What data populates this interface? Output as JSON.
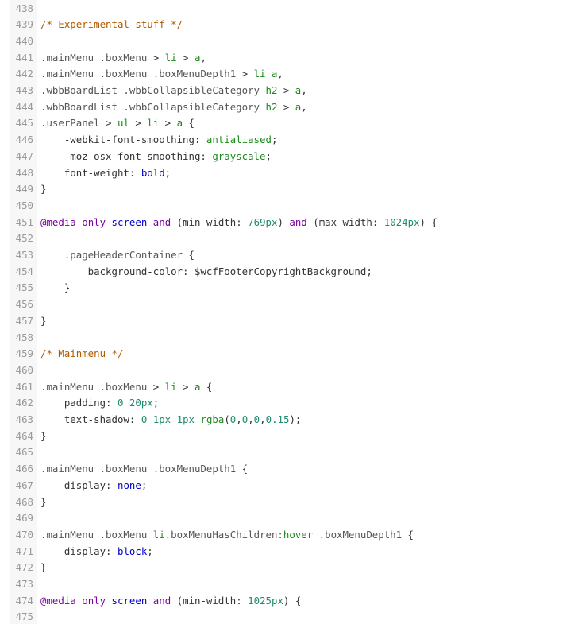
{
  "lines": [
    {
      "n": "438",
      "tokens": []
    },
    {
      "n": "439",
      "tokens": [
        {
          "c": "t-comment",
          "t": "/* Experimental stuff */"
        }
      ]
    },
    {
      "n": "440",
      "tokens": []
    },
    {
      "n": "441",
      "tokens": [
        {
          "c": "t-sel",
          "t": ".mainMenu .boxMenu "
        },
        {
          "c": "t-plain",
          "t": "> "
        },
        {
          "c": "t-tag",
          "t": "li"
        },
        {
          "c": "t-plain",
          "t": " > "
        },
        {
          "c": "t-tag",
          "t": "a"
        },
        {
          "c": "t-plain",
          "t": ","
        }
      ]
    },
    {
      "n": "442",
      "tokens": [
        {
          "c": "t-sel",
          "t": ".mainMenu .boxMenu .boxMenuDepth1 "
        },
        {
          "c": "t-plain",
          "t": "> "
        },
        {
          "c": "t-tag",
          "t": "li"
        },
        {
          "c": "t-plain",
          "t": " "
        },
        {
          "c": "t-tag",
          "t": "a"
        },
        {
          "c": "t-plain",
          "t": ","
        }
      ]
    },
    {
      "n": "443",
      "tokens": [
        {
          "c": "t-sel",
          "t": ".wbbBoardList .wbbCollapsibleCategory "
        },
        {
          "c": "t-tag",
          "t": "h2"
        },
        {
          "c": "t-plain",
          "t": " > "
        },
        {
          "c": "t-tag",
          "t": "a"
        },
        {
          "c": "t-plain",
          "t": ","
        }
      ]
    },
    {
      "n": "444",
      "tokens": [
        {
          "c": "t-sel",
          "t": ".wbbBoardList .wbbCollapsibleCategory "
        },
        {
          "c": "t-tag",
          "t": "h2"
        },
        {
          "c": "t-plain",
          "t": " > "
        },
        {
          "c": "t-tag",
          "t": "a"
        },
        {
          "c": "t-plain",
          "t": ","
        }
      ]
    },
    {
      "n": "445",
      "tokens": [
        {
          "c": "t-sel",
          "t": ".userPanel "
        },
        {
          "c": "t-plain",
          "t": "> "
        },
        {
          "c": "t-tag",
          "t": "ul"
        },
        {
          "c": "t-plain",
          "t": " > "
        },
        {
          "c": "t-tag",
          "t": "li"
        },
        {
          "c": "t-plain",
          "t": " > "
        },
        {
          "c": "t-tag",
          "t": "a"
        },
        {
          "c": "t-plain",
          "t": " {"
        }
      ]
    },
    {
      "n": "446",
      "tokens": [
        {
          "c": "t-prop",
          "t": "    -webkit-font-smoothing: "
        },
        {
          "c": "t-val",
          "t": "antialiased"
        },
        {
          "c": "t-plain",
          "t": ";"
        }
      ]
    },
    {
      "n": "447",
      "tokens": [
        {
          "c": "t-prop",
          "t": "    -moz-osx-font-smoothing: "
        },
        {
          "c": "t-val",
          "t": "grayscale"
        },
        {
          "c": "t-plain",
          "t": ";"
        }
      ]
    },
    {
      "n": "448",
      "tokens": [
        {
          "c": "t-prop",
          "t": "    font-weight: "
        },
        {
          "c": "t-kw",
          "t": "bold"
        },
        {
          "c": "t-plain",
          "t": ";"
        }
      ]
    },
    {
      "n": "449",
      "tokens": [
        {
          "c": "t-plain",
          "t": "}"
        }
      ]
    },
    {
      "n": "450",
      "tokens": []
    },
    {
      "n": "451",
      "tokens": [
        {
          "c": "t-at",
          "t": "@media"
        },
        {
          "c": "t-plain",
          "t": " "
        },
        {
          "c": "t-at",
          "t": "only"
        },
        {
          "c": "t-plain",
          "t": " "
        },
        {
          "c": "t-kw",
          "t": "screen"
        },
        {
          "c": "t-plain",
          "t": " "
        },
        {
          "c": "t-at",
          "t": "and"
        },
        {
          "c": "t-plain",
          "t": " (min-width: "
        },
        {
          "c": "t-num",
          "t": "769px"
        },
        {
          "c": "t-plain",
          "t": ") "
        },
        {
          "c": "t-at",
          "t": "and"
        },
        {
          "c": "t-plain",
          "t": " (max-width: "
        },
        {
          "c": "t-num",
          "t": "1024px"
        },
        {
          "c": "t-plain",
          "t": ") {"
        }
      ]
    },
    {
      "n": "452",
      "tokens": []
    },
    {
      "n": "453",
      "tokens": [
        {
          "c": "t-sel",
          "t": "    .pageHeaderContainer "
        },
        {
          "c": "t-plain",
          "t": "{"
        }
      ]
    },
    {
      "n": "454",
      "tokens": [
        {
          "c": "t-prop",
          "t": "        background-color: "
        },
        {
          "c": "t-var",
          "t": "$wcfFooterCopyrightBackground"
        },
        {
          "c": "t-plain",
          "t": ";"
        }
      ]
    },
    {
      "n": "455",
      "tokens": [
        {
          "c": "t-plain",
          "t": "    }"
        }
      ]
    },
    {
      "n": "456",
      "tokens": []
    },
    {
      "n": "457",
      "tokens": [
        {
          "c": "t-plain",
          "t": "}"
        }
      ]
    },
    {
      "n": "458",
      "tokens": []
    },
    {
      "n": "459",
      "tokens": [
        {
          "c": "t-comment",
          "t": "/* Mainmenu */"
        }
      ]
    },
    {
      "n": "460",
      "tokens": []
    },
    {
      "n": "461",
      "tokens": [
        {
          "c": "t-sel",
          "t": ".mainMenu .boxMenu "
        },
        {
          "c": "t-plain",
          "t": "> "
        },
        {
          "c": "t-tag",
          "t": "li"
        },
        {
          "c": "t-plain",
          "t": " > "
        },
        {
          "c": "t-tag",
          "t": "a"
        },
        {
          "c": "t-plain",
          "t": " {"
        }
      ]
    },
    {
      "n": "462",
      "tokens": [
        {
          "c": "t-prop",
          "t": "    padding: "
        },
        {
          "c": "t-num",
          "t": "0"
        },
        {
          "c": "t-plain",
          "t": " "
        },
        {
          "c": "t-num",
          "t": "20px"
        },
        {
          "c": "t-plain",
          "t": ";"
        }
      ]
    },
    {
      "n": "463",
      "tokens": [
        {
          "c": "t-prop",
          "t": "    text-shadow: "
        },
        {
          "c": "t-num",
          "t": "0"
        },
        {
          "c": "t-plain",
          "t": " "
        },
        {
          "c": "t-num",
          "t": "1px"
        },
        {
          "c": "t-plain",
          "t": " "
        },
        {
          "c": "t-num",
          "t": "1px"
        },
        {
          "c": "t-plain",
          "t": " "
        },
        {
          "c": "t-tag",
          "t": "rgba"
        },
        {
          "c": "t-plain",
          "t": "("
        },
        {
          "c": "t-num",
          "t": "0"
        },
        {
          "c": "t-plain",
          "t": ","
        },
        {
          "c": "t-num",
          "t": "0"
        },
        {
          "c": "t-plain",
          "t": ","
        },
        {
          "c": "t-num",
          "t": "0"
        },
        {
          "c": "t-plain",
          "t": ","
        },
        {
          "c": "t-num",
          "t": "0.15"
        },
        {
          "c": "t-plain",
          "t": ");"
        }
      ]
    },
    {
      "n": "464",
      "tokens": [
        {
          "c": "t-plain",
          "t": "}"
        }
      ]
    },
    {
      "n": "465",
      "tokens": []
    },
    {
      "n": "466",
      "tokens": [
        {
          "c": "t-sel",
          "t": ".mainMenu .boxMenu .boxMenuDepth1 "
        },
        {
          "c": "t-plain",
          "t": "{"
        }
      ]
    },
    {
      "n": "467",
      "tokens": [
        {
          "c": "t-prop",
          "t": "    display: "
        },
        {
          "c": "t-kw",
          "t": "none"
        },
        {
          "c": "t-plain",
          "t": ";"
        }
      ]
    },
    {
      "n": "468",
      "tokens": [
        {
          "c": "t-plain",
          "t": "}"
        }
      ]
    },
    {
      "n": "469",
      "tokens": []
    },
    {
      "n": "470",
      "tokens": [
        {
          "c": "t-sel",
          "t": ".mainMenu .boxMenu "
        },
        {
          "c": "t-tag",
          "t": "li"
        },
        {
          "c": "t-sel",
          "t": ".boxMenuHasChildren:"
        },
        {
          "c": "t-tag",
          "t": "hover"
        },
        {
          "c": "t-sel",
          "t": " .boxMenuDepth1 "
        },
        {
          "c": "t-plain",
          "t": "{"
        }
      ]
    },
    {
      "n": "471",
      "tokens": [
        {
          "c": "t-prop",
          "t": "    display: "
        },
        {
          "c": "t-kw",
          "t": "block"
        },
        {
          "c": "t-plain",
          "t": ";"
        }
      ]
    },
    {
      "n": "472",
      "tokens": [
        {
          "c": "t-plain",
          "t": "}"
        }
      ]
    },
    {
      "n": "473",
      "tokens": []
    },
    {
      "n": "474",
      "tokens": [
        {
          "c": "t-at",
          "t": "@media"
        },
        {
          "c": "t-plain",
          "t": " "
        },
        {
          "c": "t-at",
          "t": "only"
        },
        {
          "c": "t-plain",
          "t": " "
        },
        {
          "c": "t-kw",
          "t": "screen"
        },
        {
          "c": "t-plain",
          "t": " "
        },
        {
          "c": "t-at",
          "t": "and"
        },
        {
          "c": "t-plain",
          "t": " (min-width: "
        },
        {
          "c": "t-num",
          "t": "1025px"
        },
        {
          "c": "t-plain",
          "t": ") {"
        }
      ]
    },
    {
      "n": "475",
      "tokens": []
    }
  ]
}
